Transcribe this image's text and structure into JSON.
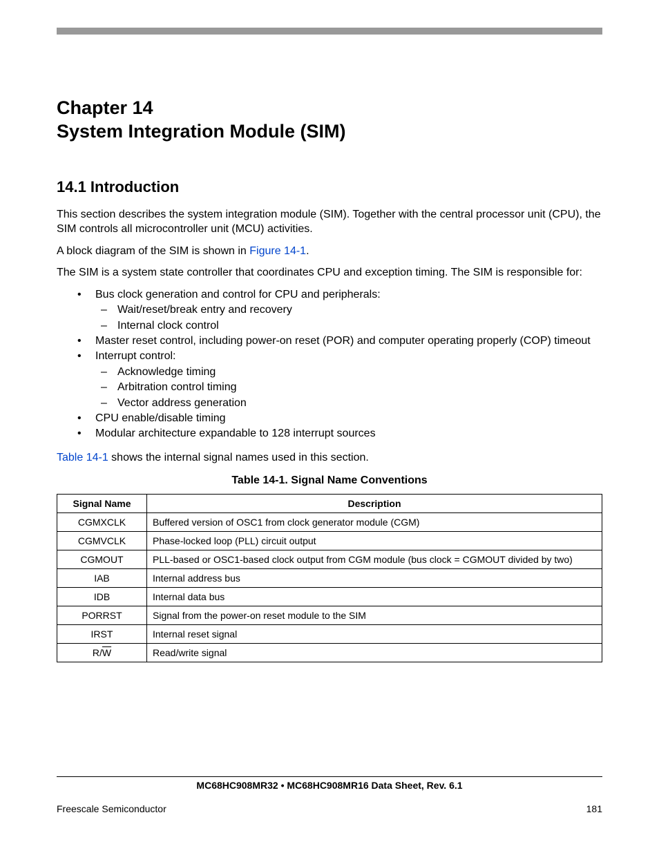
{
  "chapter": {
    "line1": "Chapter 14",
    "line2": "System Integration Module (SIM)"
  },
  "section": {
    "number_title": "14.1  Introduction"
  },
  "paragraphs": {
    "p1": "This section describes the system integration module (SIM). Together with the central processor unit (CPU), the SIM controls all microcontroller unit (MCU) activities.",
    "p2_pre": "A block diagram of the SIM is shown in ",
    "p2_link": "Figure 14-1",
    "p2_post": ".",
    "p3": "The SIM is a system state controller that coordinates CPU and exception timing. The SIM is responsible for:",
    "p4_link": "Table 14-1",
    "p4_post": " shows the internal signal names used in this section."
  },
  "bullets": {
    "b1": "Bus clock generation and control for CPU and peripherals:",
    "b1a": "Wait/reset/break entry and recovery",
    "b1b": "Internal clock control",
    "b2": "Master reset control, including power-on reset (POR) and computer operating properly (COP) timeout",
    "b3": "Interrupt control:",
    "b3a": "Acknowledge timing",
    "b3b": "Arbitration control timing",
    "b3c": "Vector address generation",
    "b4": "CPU enable/disable timing",
    "b5": "Modular architecture expandable to 128 interrupt sources"
  },
  "table": {
    "caption": "Table 14-1. Signal Name Conventions",
    "header": {
      "c1": "Signal Name",
      "c2": "Description"
    },
    "rows": [
      {
        "signal": "CGMXCLK",
        "desc": "Buffered version of OSC1 from clock generator module (CGM)"
      },
      {
        "signal": "CGMVCLK",
        "desc": "Phase-locked loop (PLL) circuit output"
      },
      {
        "signal": "CGMOUT",
        "desc": "PLL-based or OSC1-based clock output from CGM module (bus clock  = CGMOUT divided by two)"
      },
      {
        "signal": "IAB",
        "desc": "Internal address bus"
      },
      {
        "signal": "IDB",
        "desc": "Internal data bus"
      },
      {
        "signal": "PORRST",
        "desc": "Signal from the power-on reset module to the SIM"
      },
      {
        "signal": "IRST",
        "desc": "Internal reset signal"
      },
      {
        "signal_pre": "R/",
        "signal_over": "W",
        "desc": "Read/write signal"
      }
    ]
  },
  "footer": {
    "doc_title": "MC68HC908MR32 • MC68HC908MR16 Data Sheet, Rev. 6.1",
    "company": "Freescale Semiconductor",
    "page": "181"
  }
}
